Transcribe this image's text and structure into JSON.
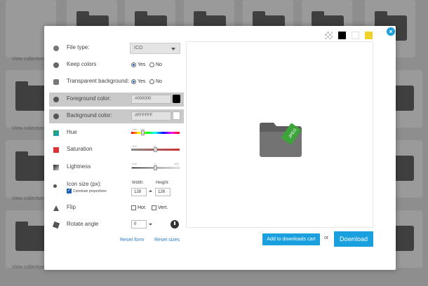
{
  "background": {
    "view_collection_label": "View collection"
  },
  "form": {
    "file_type": {
      "label": "File type:",
      "value": "ICO"
    },
    "keep_colors": {
      "label": "Keep colors",
      "yes": "Yes",
      "no": "No"
    },
    "transparent_background": {
      "label": "Transparent background:",
      "yes": "Yes",
      "no": "No"
    },
    "foreground_color": {
      "label": "Foreground color:",
      "value": "#000000",
      "swatch": "#000000"
    },
    "background_color": {
      "label": "Background color:",
      "value": "#FFFFFF",
      "swatch": "#ffffff"
    },
    "hue": {
      "label": "Hue",
      "min": "-180",
      "max": "+90",
      "level": 0.25
    },
    "saturation": {
      "label": "Saturation",
      "min": "-100",
      "mid": "0",
      "level": 0.5
    },
    "lightness": {
      "label": "Lightness",
      "min": "-100",
      "mid": "0",
      "max": "100",
      "level": 0.5
    },
    "icon_size": {
      "label": "Icon size (px):",
      "constrain_label": "Constrain proportions",
      "width_label": "Width:",
      "height_label": "Height:",
      "width": "128",
      "height": "128"
    },
    "flip": {
      "label": "Flip",
      "hor": "Hor.",
      "vert": "Vert."
    },
    "rotate": {
      "label": "Rotate angle",
      "value": "0"
    }
  },
  "links": {
    "reset_form": "Reset form",
    "reset_sizes": "Reset sizes"
  },
  "preview": {
    "badge_text": "JPEG"
  },
  "actions": {
    "add_to_cart": "Add to downloads cart",
    "or": "or",
    "download": "Download",
    "close": "×"
  },
  "colors": {
    "accent": "#1a9fdf",
    "highlight_row": "#c9c9c9",
    "badge_green": "#3da33b"
  }
}
